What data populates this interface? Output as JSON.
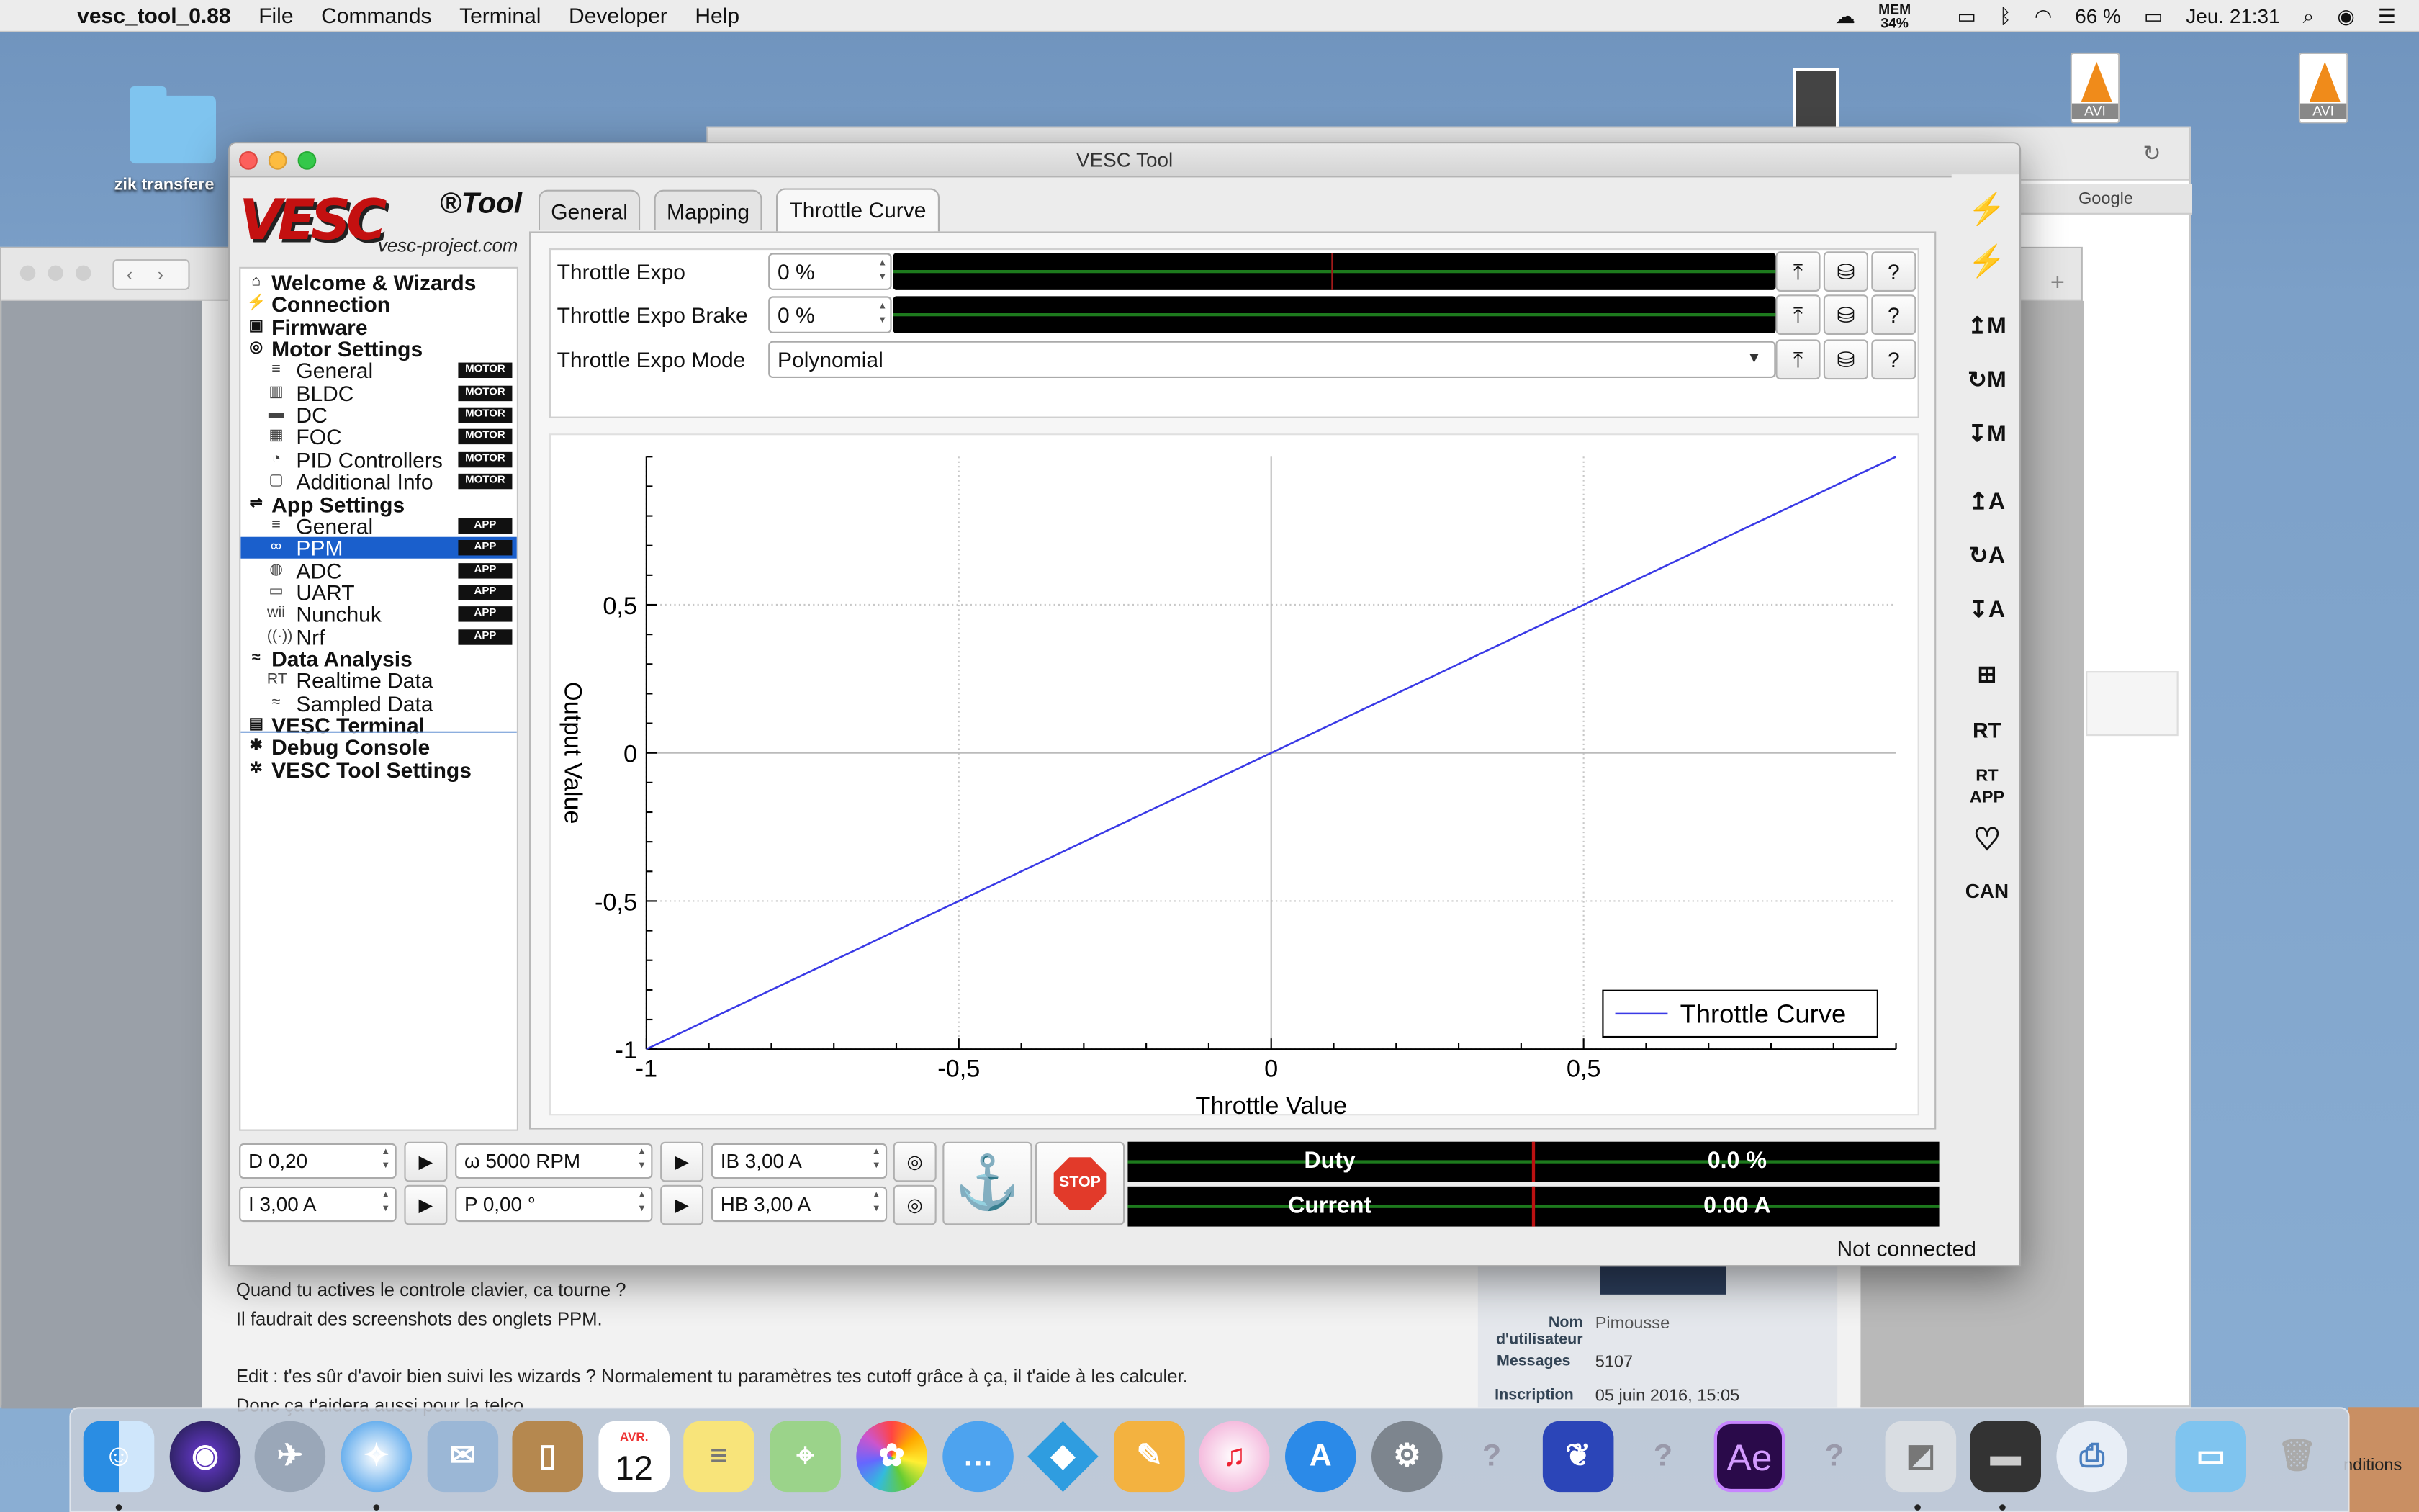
{
  "menubar": {
    "app_name": "vesc_tool_0.88",
    "items": [
      "File",
      "Commands",
      "Terminal",
      "Developer",
      "Help"
    ],
    "mem_label": "MEM",
    "mem_value": "34%",
    "battery": "66 %",
    "clock": "Jeu. 21:31"
  },
  "desktop": {
    "folder_label": "zik transfere",
    "file_type": "AVI",
    "google_label": "Google",
    "conditions": "nditions"
  },
  "window": {
    "title": "VESC Tool",
    "logo_main": "VESC",
    "logo_tool": "®Tool",
    "logo_url": "vesc-project.com",
    "status": "Not connected"
  },
  "sidebar": {
    "items": [
      {
        "label": "Welcome & Wizards",
        "level": "top",
        "icon": "home-icon",
        "glyph": "⌂"
      },
      {
        "label": "Connection",
        "level": "top",
        "icon": "plug-icon",
        "glyph": "⚡"
      },
      {
        "label": "Firmware",
        "level": "top",
        "icon": "chip-icon",
        "glyph": "▣"
      },
      {
        "label": "Motor Settings",
        "level": "top",
        "icon": "motor-icon",
        "glyph": "◎"
      },
      {
        "label": "General",
        "level": "sub",
        "icon": "sliders-icon",
        "glyph": "≡",
        "badge": "MOTOR"
      },
      {
        "label": "BLDC",
        "level": "sub",
        "icon": "bldc-icon",
        "glyph": "▥",
        "badge": "MOTOR"
      },
      {
        "label": "DC",
        "level": "sub",
        "icon": "dc-motor-icon",
        "glyph": "▬",
        "badge": "MOTOR"
      },
      {
        "label": "FOC",
        "level": "sub",
        "icon": "foc-icon",
        "glyph": "▦",
        "badge": "MOTOR"
      },
      {
        "label": "PID Controllers",
        "level": "sub",
        "icon": "gauge-icon",
        "glyph": "◔",
        "badge": "MOTOR"
      },
      {
        "label": "Additional Info",
        "level": "sub",
        "icon": "info-bubble-icon",
        "glyph": "▢",
        "badge": "MOTOR"
      },
      {
        "label": "App Settings",
        "level": "top",
        "icon": "app-settings-icon",
        "glyph": "⇌"
      },
      {
        "label": "General",
        "level": "sub",
        "icon": "sliders-icon",
        "glyph": "≡",
        "badge": "APP"
      },
      {
        "label": "PPM",
        "level": "sub",
        "icon": "ppm-icon",
        "glyph": "∞",
        "badge": "APP",
        "selected": true
      },
      {
        "label": "ADC",
        "level": "sub",
        "icon": "adc-icon",
        "glyph": "◍",
        "badge": "APP"
      },
      {
        "label": "UART",
        "level": "sub",
        "icon": "uart-icon",
        "glyph": "▭",
        "badge": "APP"
      },
      {
        "label": "Nunchuk",
        "level": "sub",
        "icon": "wii-icon",
        "glyph": "wii",
        "badge": "APP"
      },
      {
        "label": "Nrf",
        "level": "sub",
        "icon": "wireless-icon",
        "glyph": "((·))",
        "badge": "APP"
      },
      {
        "label": "Data Analysis",
        "level": "top",
        "icon": "chart-icon",
        "glyph": "≈"
      },
      {
        "label": "Realtime Data",
        "level": "sub",
        "icon": "realtime-icon",
        "glyph": "RT"
      },
      {
        "label": "Sampled Data",
        "level": "sub",
        "icon": "sampled-icon",
        "glyph": "≈"
      },
      {
        "label": "VESC Terminal",
        "level": "top",
        "icon": "terminal-icon",
        "glyph": "▤"
      },
      {
        "label": "Debug Console",
        "level": "top",
        "icon": "bug-icon",
        "glyph": "✱"
      },
      {
        "label": "VESC Tool Settings",
        "level": "top",
        "icon": "gear-icon",
        "glyph": "✲"
      }
    ]
  },
  "tabs": [
    "General",
    "Mapping",
    "Throttle Curve"
  ],
  "params": {
    "expo_label": "Throttle Expo",
    "expo_value": "0 %",
    "expo_brake_label": "Throttle Expo Brake",
    "expo_brake_value": "0 %",
    "mode_label": "Throttle Expo Mode",
    "mode_value": "Polynomial"
  },
  "chart_data": {
    "type": "line",
    "xlabel": "Throttle Value",
    "ylabel": "Output Value",
    "xlim": [
      -1,
      1
    ],
    "ylim": [
      -1,
      1
    ],
    "x_ticks": [
      "-1",
      "-0,5",
      "0",
      "0,5"
    ],
    "y_ticks": [
      "-1",
      "-0,5",
      "0",
      "0,5"
    ],
    "grid": true,
    "legend_position": "bottom-right",
    "series": [
      {
        "name": "Throttle Curve",
        "color": "#3a3ae6",
        "x": [
          -1,
          1
        ],
        "y": [
          -1,
          1
        ]
      }
    ]
  },
  "bottom": {
    "duty_spin": "D 0,20",
    "rpm_spin": "ω 5000 RPM",
    "ib_spin": "IB 3,00 A",
    "current_spin": "I 3,00 A",
    "pos_spin": "P 0,00 °",
    "hb_spin": "HB 3,00 A",
    "stop_label": "STOP",
    "duty_label": "Duty",
    "duty_value": "0.0 %",
    "current_label": "Current",
    "current_value": "0.00 A"
  },
  "forum": {
    "line1": "Quand tu actives le controle clavier, ca tourne ?",
    "line2": "Il faudrait des screenshots des onglets PPM.",
    "line3": "Edit : t'es sûr d'avoir bien suivi les wizards ? Normalement tu paramètres tes cutoff grâce à ça, il t'aide à les calculer.",
    "line4": "Donc ça t'aidera aussi pour la telco",
    "name_label": "Nom d'utilisateur",
    "name_value": "Pimousse",
    "messages_label": "Messages",
    "messages_value": "5107",
    "inscription_label": "Inscription",
    "inscription_value": "05 juin 2016, 15:05"
  },
  "dock": {
    "calendar_month": "AVR.",
    "calendar_day": "12",
    "ae_label": "Ae"
  },
  "colors": {
    "selection": "#1a5fcc",
    "logo_red": "#c41010",
    "curve": "#3a3ae6",
    "stop_red": "#e23a2a"
  }
}
